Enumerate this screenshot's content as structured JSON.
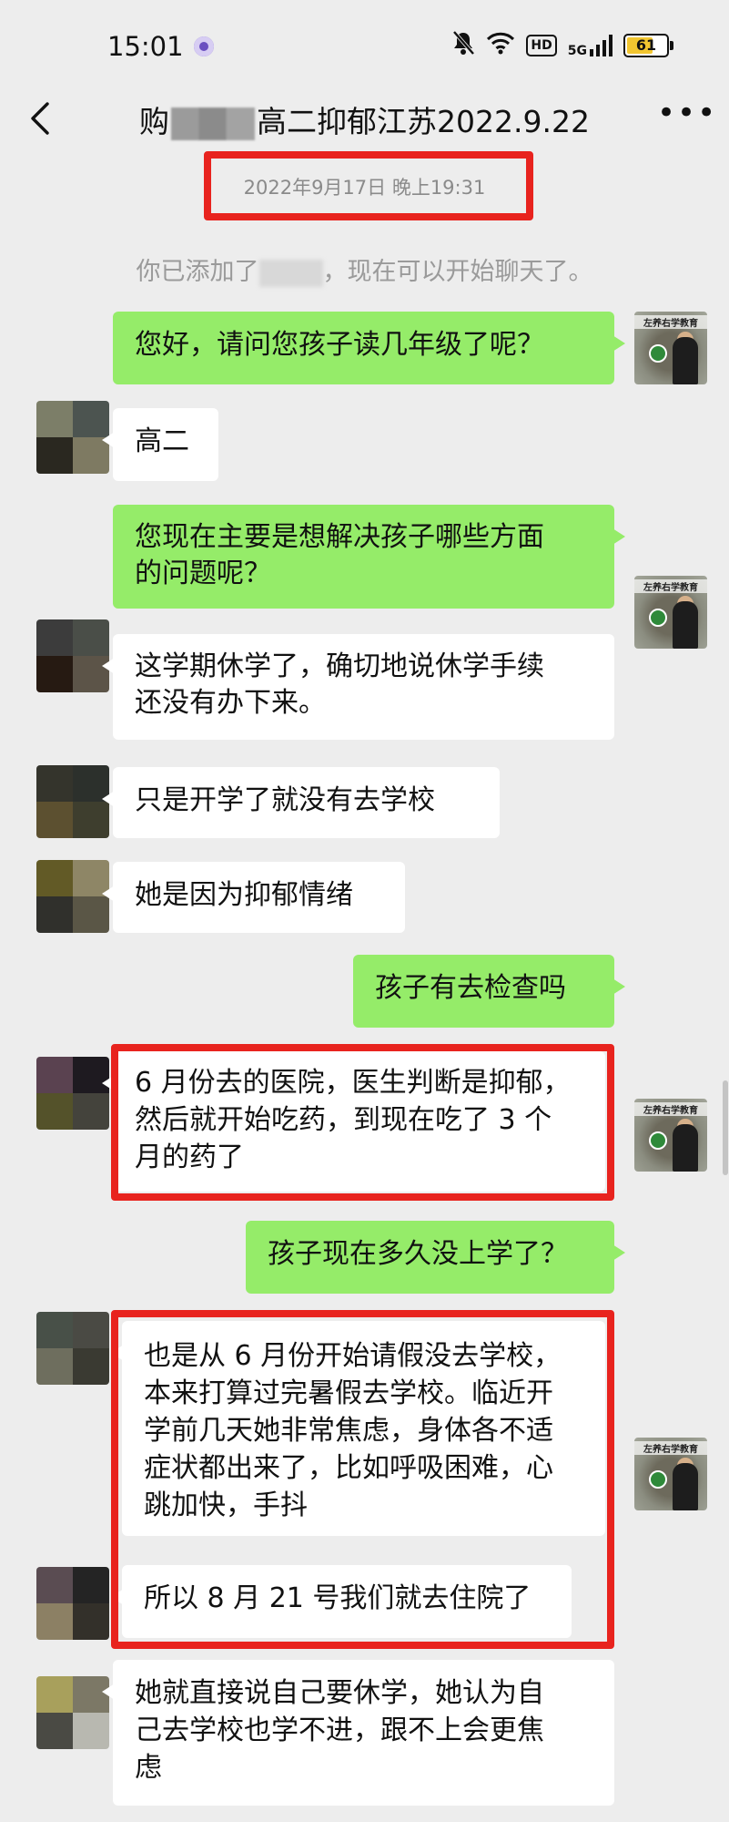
{
  "status_bar": {
    "time": "15:01",
    "icons": [
      "purple-dot-app-icon",
      "bell-muted-icon",
      "wifi-icon",
      "hd-icon",
      "signal-5g-icon",
      "battery-icon"
    ],
    "hd_label": "HD",
    "network": "5G",
    "battery": "61",
    "battery_color": "#f2c630"
  },
  "header": {
    "title_prefix": "购",
    "title_suffix": "高二抑郁江苏2022.9.22"
  },
  "timestamp": "2022年9月17日 晚上19:31",
  "system_message": {
    "prefix": "你已添加了",
    "suffix": "，现在可以开始聊天了。"
  },
  "colors": {
    "bubble_me": "#95ec69",
    "bubble_them": "#ffffff",
    "highlight_red": "#e8231e",
    "background": "#ededed"
  },
  "messages": [
    {
      "sender": "me",
      "text": "您好，请问您孩子读几年级了呢？"
    },
    {
      "sender": "them",
      "text": "高二"
    },
    {
      "sender": "me",
      "text": "您现在主要是想解决孩子哪些方面\n的问题呢？"
    },
    {
      "sender": "them",
      "text": "这学期休学了，确切地说休学手续\n还没有办下来。"
    },
    {
      "sender": "them",
      "text": "只是开学了就没有去学校"
    },
    {
      "sender": "them",
      "text": "她是因为抑郁情绪"
    },
    {
      "sender": "me",
      "text": "孩子有去检查吗"
    },
    {
      "sender": "them",
      "text": "6 月份去的医院，医生判断是抑郁，\n然后就开始吃药，到现在吃了 3 个\n月的药了"
    },
    {
      "sender": "me",
      "text": "孩子现在多久没上学了？"
    },
    {
      "sender": "them",
      "text": "也是从 6 月份开始请假没去学校，\n本来打算过完暑假去学校。临近开\n学前几天她非常焦虑，身体各不适\n症状都出来了，比如呼吸困难，心\n跳加快，手抖"
    },
    {
      "sender": "them",
      "text": "所以 8 月 21 号我们就去住院了"
    },
    {
      "sender": "them",
      "text": "她就直接说自己要休学，她认为自\n己去学校也学不进，跟不上会更焦\n虑"
    }
  ],
  "avatar_me": {
    "brand_text": "左养右学教育"
  }
}
